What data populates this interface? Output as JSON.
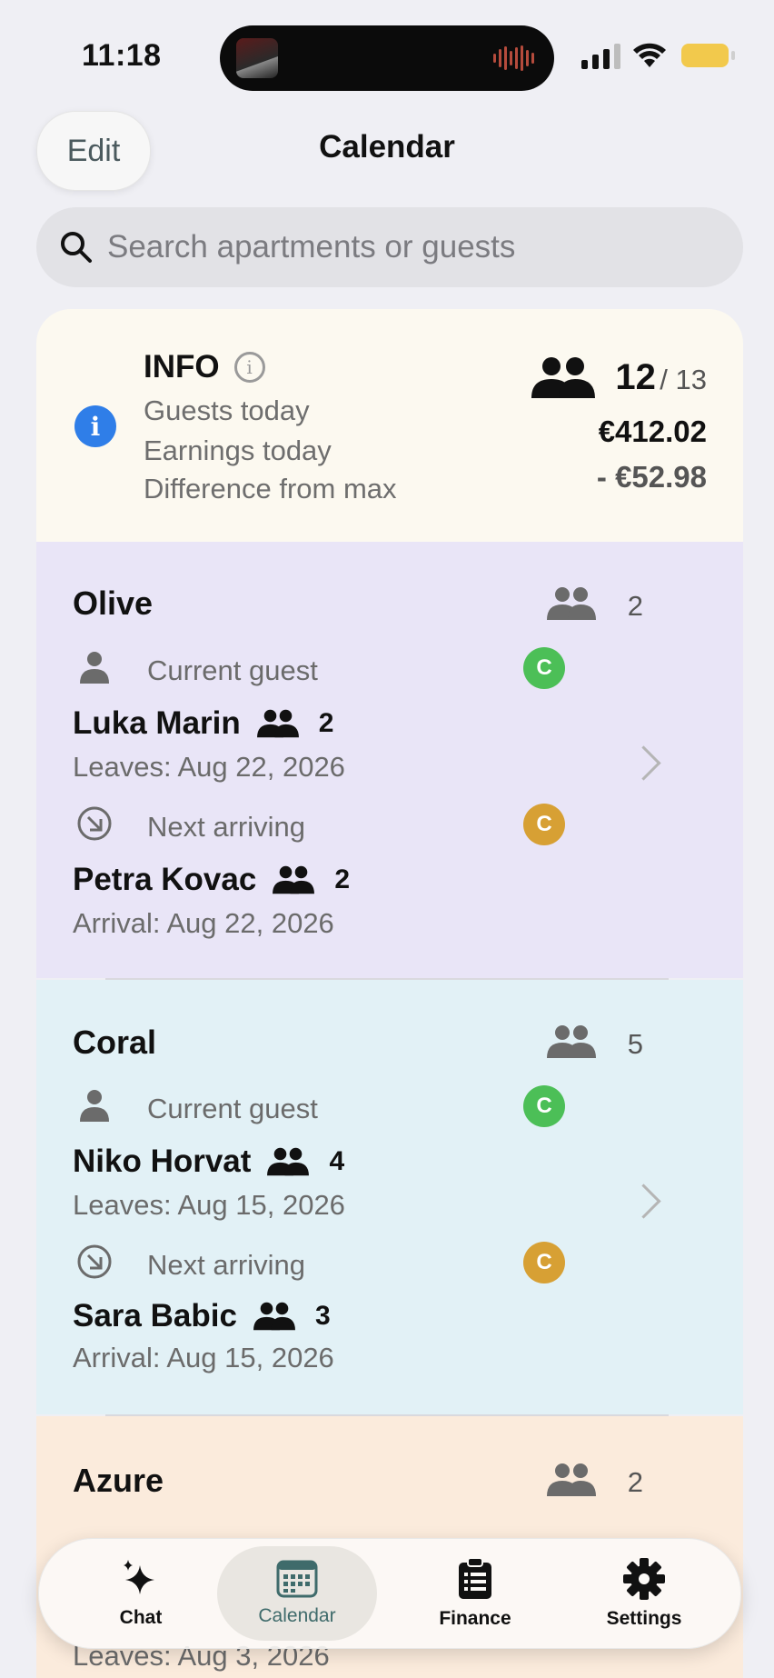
{
  "status_bar": {
    "time": "11:18"
  },
  "nav": {
    "edit_label": "Edit",
    "title": "Calendar"
  },
  "search": {
    "placeholder": "Search apartments or guests"
  },
  "info": {
    "heading": "INFO",
    "labels": [
      "Guests today",
      "Earnings today",
      "Difference from max"
    ],
    "guests_today": "12",
    "guests_max": "/ 13",
    "earnings_today": "€412.02",
    "difference_from_max": "- €52.98"
  },
  "apartments": [
    {
      "name": "Olive",
      "capacity": "2",
      "current_label": "Current guest",
      "current_guest": "Luka Marin",
      "current_count": "2",
      "current_date": "Leaves: Aug 22, 2026",
      "current_badge": "C",
      "next_label": "Next arriving",
      "next_guest": "Petra Kovac",
      "next_count": "2",
      "next_date": "Arrival: Aug 22, 2026",
      "next_badge": "C",
      "bg": "#e9e5f7"
    },
    {
      "name": "Coral",
      "capacity": "5",
      "current_label": "Current guest",
      "current_guest": "Niko Horvat",
      "current_count": "4",
      "current_date": "Leaves: Aug 15, 2026",
      "current_badge": "C",
      "next_label": "Next arriving",
      "next_guest": "Sara Babic",
      "next_count": "3",
      "next_date": "Arrival: Aug 15, 2026",
      "next_badge": "C",
      "bg": "#e2f1f6"
    },
    {
      "name": "Azure",
      "capacity": "2",
      "bg": "#fbebdc",
      "partial_date": "Leaves: Aug 3, 2026"
    }
  ],
  "tabs": [
    {
      "label": "Chat",
      "icon": "sparkles-icon"
    },
    {
      "label": "Calendar",
      "icon": "calendar-icon",
      "active": true
    },
    {
      "label": "Finance",
      "icon": "clipboard-icon"
    },
    {
      "label": "Settings",
      "icon": "gear-icon"
    }
  ],
  "colors": {
    "accent": "#3f6b6b",
    "badge_green": "#4cbf57",
    "badge_gold": "#d7a034",
    "info_blue": "#2f7ee8"
  }
}
